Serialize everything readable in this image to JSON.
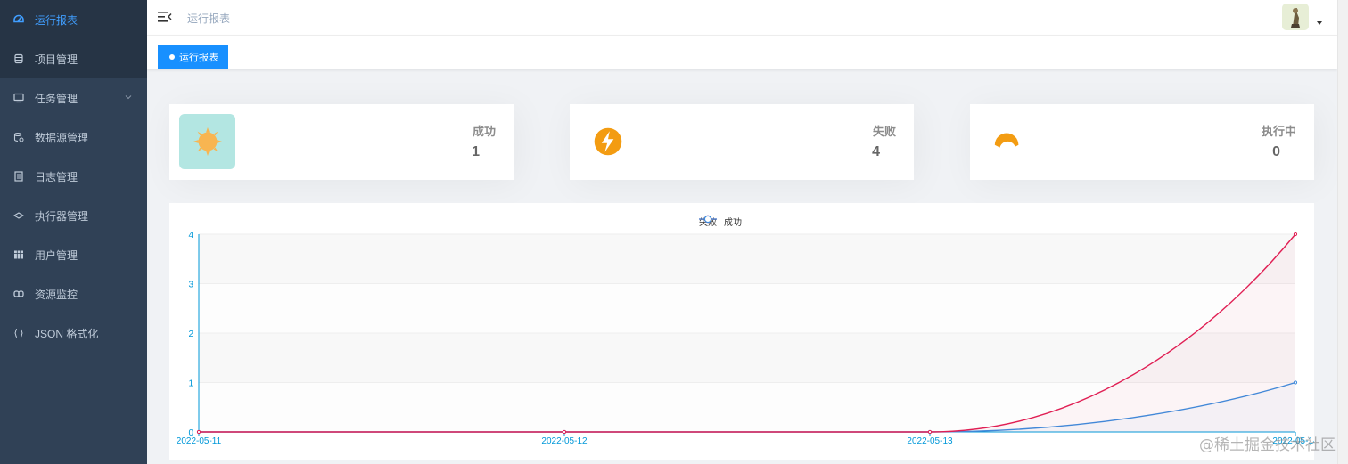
{
  "sidebar": {
    "items": [
      {
        "label": "运行报表",
        "icon": "dashboard-icon"
      },
      {
        "label": "项目管理",
        "icon": "database-icon"
      },
      {
        "label": "任务管理",
        "icon": "monitor-icon"
      },
      {
        "label": "数据源管理",
        "icon": "datasource-icon"
      },
      {
        "label": "日志管理",
        "icon": "document-icon"
      },
      {
        "label": "执行器管理",
        "icon": "executor-icon"
      },
      {
        "label": "用户管理",
        "icon": "table-icon"
      },
      {
        "label": "资源监控",
        "icon": "link-icon"
      },
      {
        "label": "JSON 格式化",
        "icon": "braces-icon"
      }
    ]
  },
  "navbar": {
    "breadcrumb": "运行报表"
  },
  "tags": {
    "active": "运行报表"
  },
  "stats": [
    {
      "label": "成功",
      "value": "1",
      "icon": "sun-icon"
    },
    {
      "label": "失败",
      "value": "4",
      "icon": "lightning-icon"
    },
    {
      "label": "执行中",
      "value": "0",
      "icon": "half-sun-icon"
    }
  ],
  "chart_data": {
    "type": "line",
    "x": [
      "2022-05-11",
      "2022-05-12",
      "2022-05-13",
      "2022-05-14"
    ],
    "series": [
      {
        "name": "失败",
        "values": [
          0,
          0,
          0,
          4
        ],
        "color": "#e01f54"
      },
      {
        "name": "成功",
        "values": [
          0,
          0,
          0,
          1
        ],
        "color": "#3c8dde"
      }
    ],
    "ylim": [
      0,
      4
    ],
    "yticks": [
      "0",
      "1",
      "2",
      "3",
      "4"
    ],
    "legend": "top-center",
    "grid": true,
    "smooth": true,
    "area": true
  },
  "watermark": "@稀土掘金技术社区",
  "colors": {
    "sidebar_bg": "#304156",
    "accent": "#409eff",
    "tag_bg": "#1890ff",
    "sun_orange": "#f8b551",
    "sun_bg": "#b3e6e2",
    "lightning_orange": "#f39c12"
  }
}
